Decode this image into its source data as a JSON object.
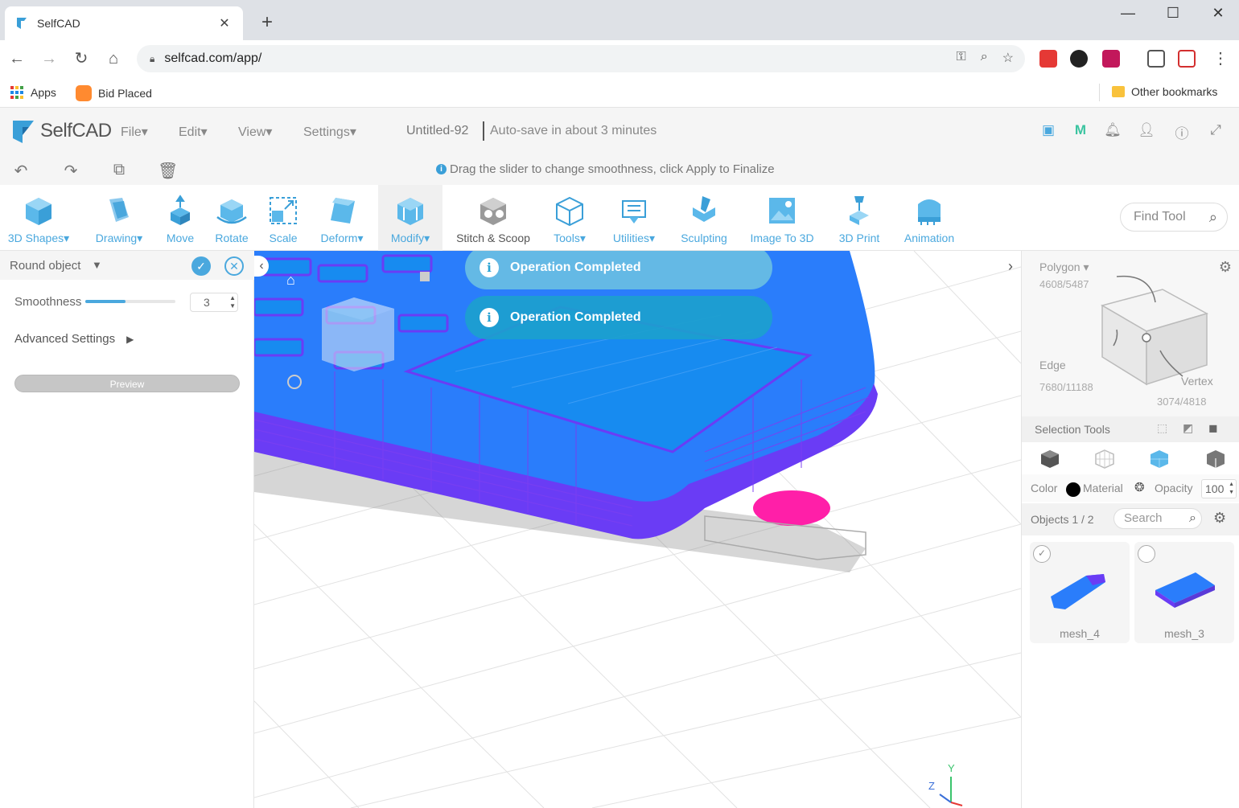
{
  "browser": {
    "tab_title": "SelfCAD",
    "tab_close": "✕",
    "new_tab": "+",
    "url": "selfcad.com/app/",
    "bookmarks": {
      "apps": "Apps",
      "bid_placed": "Bid Placed",
      "other": "Other bookmarks"
    }
  },
  "app": {
    "logo": "SelfCAD",
    "menus": [
      "File",
      "Edit",
      "View",
      "Settings"
    ],
    "doc_title": "Untitled-92",
    "autosave": "Auto-save in about 3 minutes",
    "hint": "Drag the slider to change smoothness, click Apply to Finalize"
  },
  "toolbar": {
    "tools": [
      {
        "label": "3D Shapes",
        "dropdown": true
      },
      {
        "label": "Drawing",
        "dropdown": true
      },
      {
        "label": "Move",
        "dropdown": false
      },
      {
        "label": "Rotate",
        "dropdown": false
      },
      {
        "label": "Scale",
        "dropdown": false
      },
      {
        "label": "Deform",
        "dropdown": true
      },
      {
        "label": "Modify",
        "dropdown": true
      },
      {
        "label": "Stitch & Scoop",
        "dropdown": false
      },
      {
        "label": "Tools",
        "dropdown": true
      },
      {
        "label": "Utilities",
        "dropdown": true
      },
      {
        "label": "Sculpting",
        "dropdown": false
      },
      {
        "label": "Image To 3D",
        "dropdown": false
      },
      {
        "label": "3D Print",
        "dropdown": false
      },
      {
        "label": "Animation",
        "dropdown": false
      }
    ],
    "find_tool": "Find Tool"
  },
  "left_panel": {
    "title": "Round object",
    "smoothness_label": "Smoothness",
    "smoothness_value": "3",
    "slider_fraction": 0.45,
    "advanced": "Advanced Settings",
    "preview": "Preview"
  },
  "viewport": {
    "toasts": [
      "Operation Completed",
      "Operation Completed"
    ],
    "axis_y": "Y",
    "axis_z": "Z"
  },
  "right_panel": {
    "polygon_label": "Polygon",
    "polygon_count": "4608/5487",
    "edge_label": "Edge",
    "edge_count": "7680/11188",
    "vertex_label": "Vertex",
    "vertex_count": "3074/4818",
    "selection_tools": "Selection Tools",
    "color": "Color",
    "material": "Material",
    "opacity_label": "Opacity",
    "opacity_value": "100",
    "objects": "Objects 1 / 2",
    "search": "Search",
    "objects_list": [
      {
        "name": "mesh_4",
        "checked": true
      },
      {
        "name": "mesh_3",
        "checked": false
      }
    ]
  },
  "colors": {
    "accent": "#4aa8de",
    "mesh_blue": "#1a8cff",
    "mesh_purple": "#7a3cff",
    "tip_magenta": "#ff1fa8"
  }
}
